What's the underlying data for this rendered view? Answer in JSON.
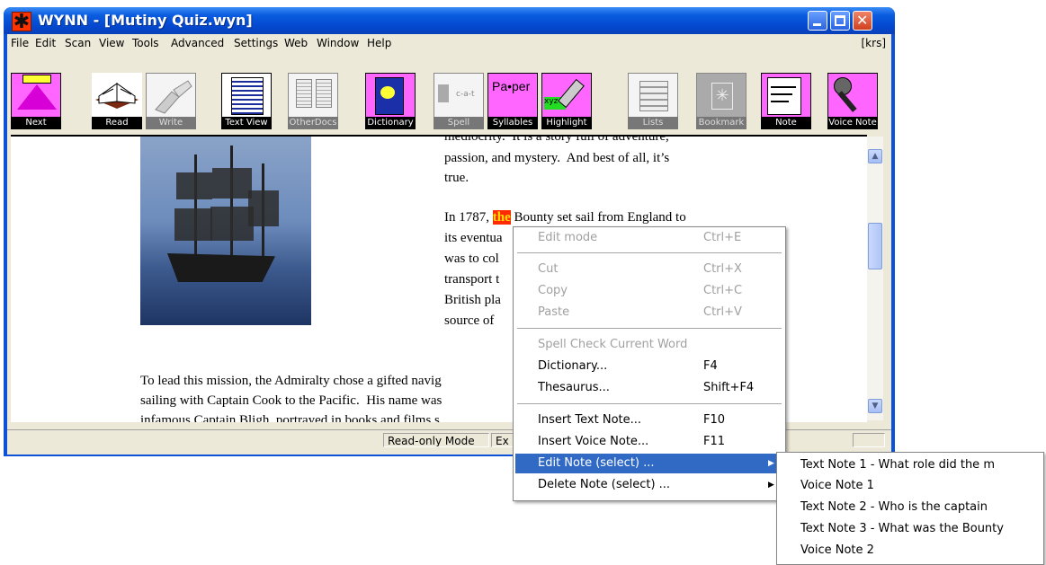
{
  "window": {
    "title": "WYNN - [Mutiny Quiz.wyn]"
  },
  "menubar": {
    "items": [
      "File",
      "Edit",
      "Scan",
      "View",
      "Tools",
      "Advanced",
      "Settings",
      "Web",
      "Window",
      "Help"
    ],
    "user": "[krs]"
  },
  "toolbar": {
    "buttons": [
      {
        "label": "Next",
        "icon": "next-arrow-icon",
        "enabled": true
      },
      {
        "label": "Read",
        "icon": "open-book-icon",
        "enabled": true
      },
      {
        "label": "Write",
        "icon": "hand-writing-icon",
        "enabled": false
      },
      {
        "label": "Text View",
        "icon": "text-page-icon",
        "enabled": true
      },
      {
        "label": "OtherDocs",
        "icon": "documents-icon",
        "enabled": false
      },
      {
        "label": "Dictionary",
        "icon": "dictionary-book-icon",
        "enabled": true
      },
      {
        "label": "Spell",
        "icon": "speaker-spell-icon",
        "enabled": false
      },
      {
        "label": "Syllables",
        "icon": "syllables-icon",
        "enabled": true
      },
      {
        "label": "Highlight",
        "icon": "highlighter-icon",
        "enabled": true
      },
      {
        "label": "Lists",
        "icon": "lists-icon",
        "enabled": false
      },
      {
        "label": "Bookmark",
        "icon": "bookmark-icon",
        "enabled": false
      },
      {
        "label": "Note",
        "icon": "notepad-icon",
        "enabled": true
      },
      {
        "label": "Voice Note",
        "icon": "microphone-icon",
        "enabled": true
      }
    ],
    "icon_text": {
      "spell": "c-a-t",
      "syllables": "Pa•per",
      "highlight": "xyz"
    }
  },
  "document": {
    "para1_lines": [
      "mediocrity.  It is a story full of adventure,",
      "passion, and mystery.  And best of all, it’s",
      "true."
    ],
    "para2_first_prefix": "In 1787, ",
    "para2_highlight": "the",
    "para2_first_suffix": " Bounty set sail from England to",
    "para2_lines": [
      "its eventua",
      "was to col",
      "transport t",
      "British pla",
      "source of"
    ],
    "para3_lines": [
      "To lead this mission, the Admiralty chose a gifted navig",
      "sailing with Captain Cook to the Pacific.  His name was",
      "infamous Captain Bligh, portrayed in books and films s"
    ]
  },
  "statusbar": {
    "mode": "Read-only Mode",
    "cell2": "Ex"
  },
  "context_menu": {
    "items": [
      {
        "label": "Edit mode",
        "shortcut": "Ctrl+E",
        "disabled": true
      },
      {
        "label": "Cut",
        "shortcut": "Ctrl+X",
        "disabled": true
      },
      {
        "label": "Copy",
        "shortcut": "Ctrl+C",
        "disabled": true
      },
      {
        "label": "Paste",
        "shortcut": "Ctrl+V",
        "disabled": true
      },
      {
        "label": "Spell Check Current Word",
        "shortcut": "",
        "disabled": true
      },
      {
        "label": "Dictionary...",
        "shortcut": "F4",
        "disabled": false
      },
      {
        "label": "Thesaurus...",
        "shortcut": "Shift+F4",
        "disabled": false
      },
      {
        "label": "Insert Text Note...",
        "shortcut": "F10",
        "disabled": false
      },
      {
        "label": "Insert Voice Note...",
        "shortcut": "F11",
        "disabled": false
      },
      {
        "label": "Edit Note (select) ...",
        "shortcut": "",
        "disabled": false,
        "selected": true
      },
      {
        "label": "Delete Note (select) ...",
        "shortcut": "",
        "disabled": false
      }
    ]
  },
  "submenu": {
    "items": [
      "Text Note 1 - What role did the m",
      "Voice Note 1",
      "Text Note 2 - Who is the captain",
      "Text Note 3 - What was the Bounty",
      "Voice Note 2"
    ]
  }
}
